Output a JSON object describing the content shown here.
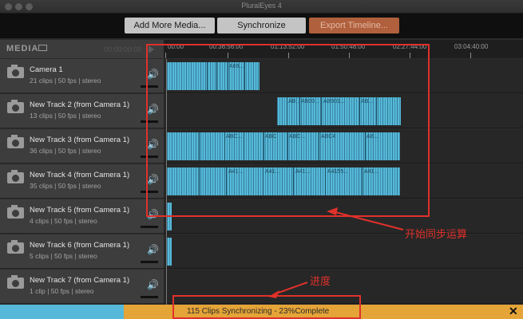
{
  "window": {
    "title": "PluralEyes 4"
  },
  "toolbar": {
    "add_media": "Add More Media...",
    "synchronize": "Synchronize",
    "export_timeline": "Export Timeline..."
  },
  "media_header": {
    "label": "MEDIA",
    "timecode": "00:00:00:00"
  },
  "ruler": {
    "ticks": [
      "00:00",
      "00:36:56:00",
      "01:13:52:00",
      "01:50:48:00",
      "02:27:44:00",
      "03:04:40:00"
    ]
  },
  "tracks": [
    {
      "name": "Camera 1",
      "meta": "21 clips  |  50 fps  |  stereo",
      "clip_labels": [
        "A69..."
      ]
    },
    {
      "name": "New Track 2 (from Camera 1)",
      "meta": "13 clips  |  50 fps  |  stereo",
      "clip_labels": [
        "AB...",
        "AB00...",
        "AB001...",
        "AB..."
      ]
    },
    {
      "name": "New Track 3 (from Camera 1)",
      "meta": "36 clips  |  50 fps  |  stereo",
      "clip_labels": [
        "ABC...",
        "ABC",
        "ABC...",
        "ABC4",
        "AB..."
      ]
    },
    {
      "name": "New Track 4 (from Camera 1)",
      "meta": "35 clips  |  50 fps  |  stereo",
      "clip_labels": [
        "A41...",
        "A41...",
        "A41...",
        "A4155...",
        "A41..."
      ]
    },
    {
      "name": "New Track 5 (from Camera 1)",
      "meta": "4 clips  |  50 fps  |  stereo",
      "clip_labels": []
    },
    {
      "name": "New Track 6 (from Camera 1)",
      "meta": "5 clips  |  50 fps  |  stereo",
      "clip_labels": []
    },
    {
      "name": "New Track 7 (from Camera 1)",
      "meta": "1 clip  |  50 fps  |  stereo",
      "clip_labels": []
    }
  ],
  "status": {
    "text": "115 Clips Synchronizing - 23%Complete",
    "progress": 0.23,
    "close": "✕"
  },
  "annotations": {
    "sync_note": "开始同步运算",
    "progress_note": "进度"
  },
  "colors": {
    "accent_blue": "#56b9d9",
    "progress_orange": "#e5a437",
    "annotation_red": "#e0312b",
    "export_button": "#b0603c"
  },
  "icons": {
    "track": "camera-icon",
    "audio": "speaker-icon",
    "media": "monitor-icon",
    "play": "play-icon"
  }
}
